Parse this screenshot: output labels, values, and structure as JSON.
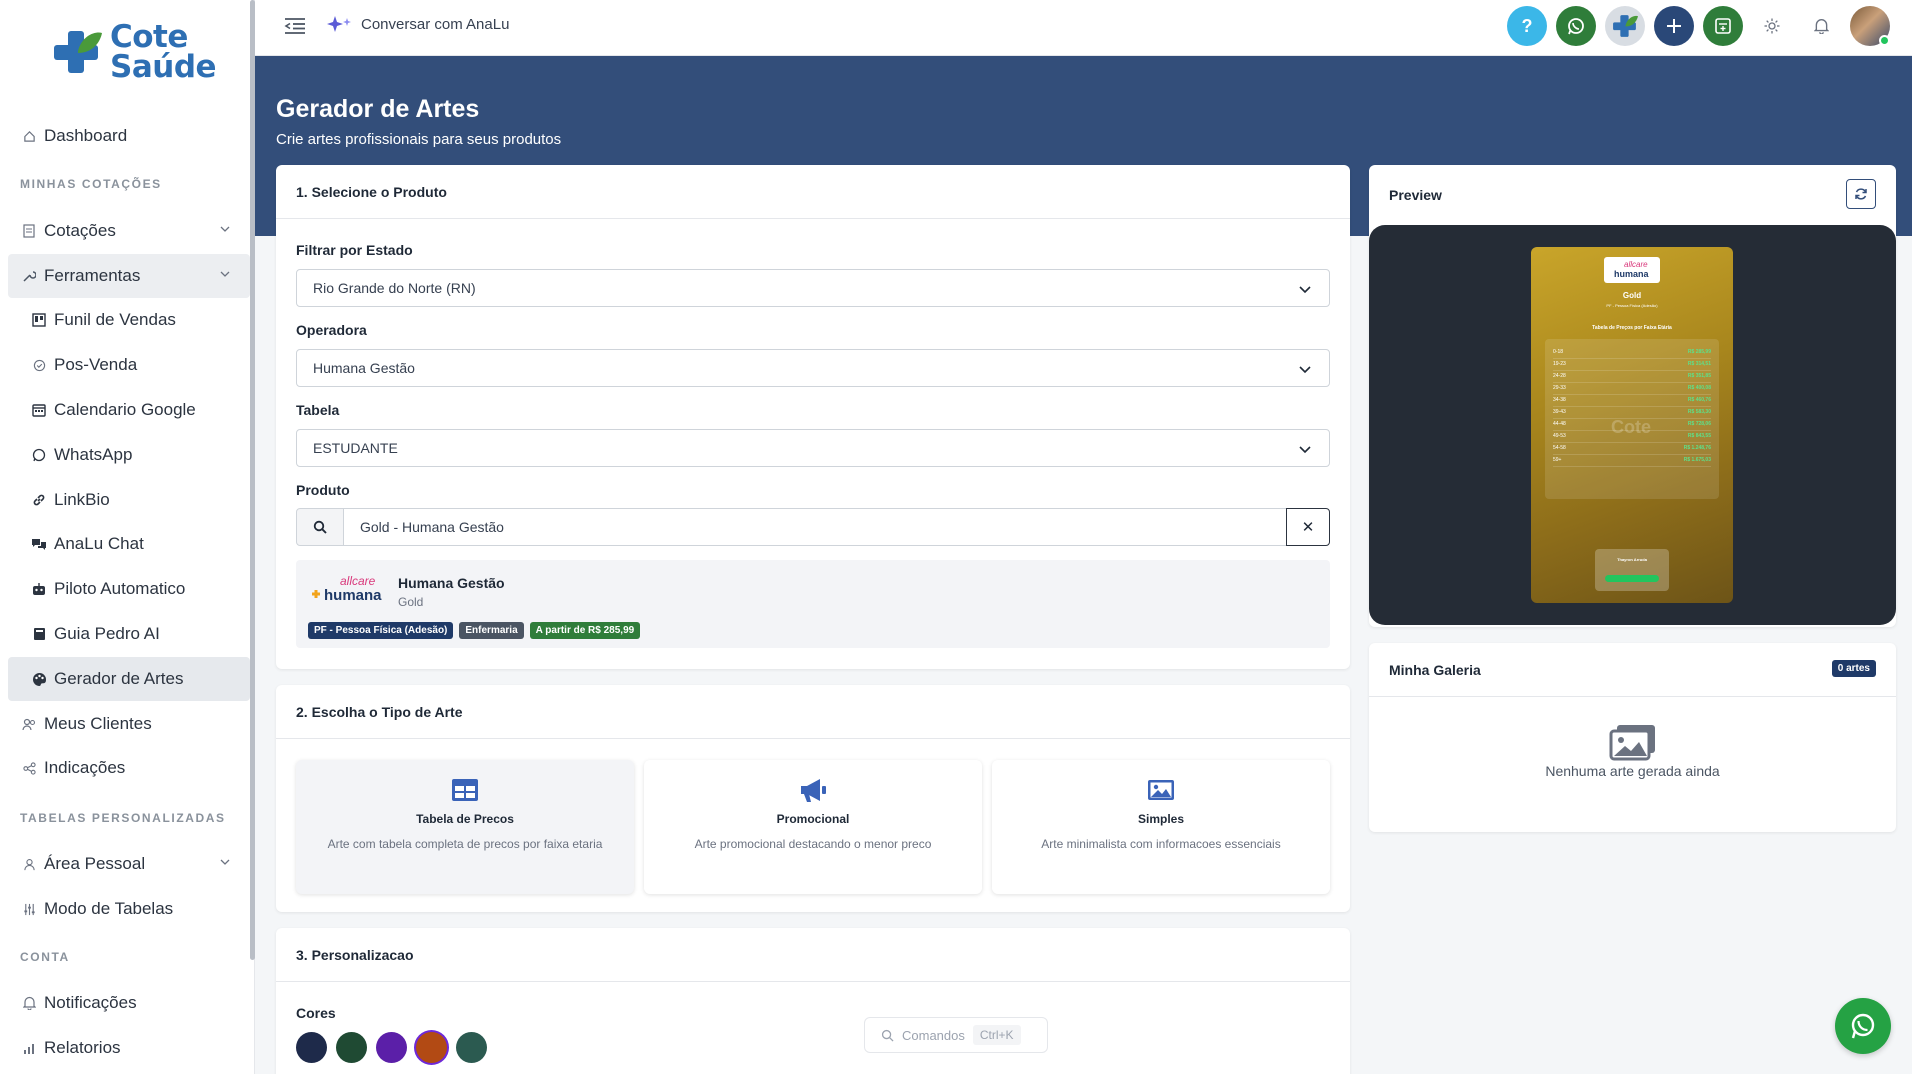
{
  "brand": {
    "line1": "Cote",
    "line2": "Saúde"
  },
  "topbar": {
    "chat_label": "Conversar com AnaLu"
  },
  "sidebar": {
    "items": [
      {
        "key": "dashboard",
        "label": "Dashboard"
      },
      {
        "key": "cotacoes",
        "label": "Cotações"
      },
      {
        "key": "ferramentas",
        "label": "Ferramentas"
      },
      {
        "key": "funil",
        "label": "Funil de Vendas"
      },
      {
        "key": "posvenda",
        "label": "Pos-Venda"
      },
      {
        "key": "calendario",
        "label": "Calendario Google"
      },
      {
        "key": "whatsapp",
        "label": "WhatsApp"
      },
      {
        "key": "linkbio",
        "label": "LinkBio"
      },
      {
        "key": "analu",
        "label": "AnaLu Chat"
      },
      {
        "key": "piloto",
        "label": "Piloto Automatico"
      },
      {
        "key": "guia",
        "label": "Guia Pedro AI"
      },
      {
        "key": "gerador",
        "label": "Gerador de Artes"
      },
      {
        "key": "clientes",
        "label": "Meus Clientes"
      },
      {
        "key": "indicacoes",
        "label": "Indicações"
      },
      {
        "key": "area",
        "label": "Área Pessoal"
      },
      {
        "key": "modo",
        "label": "Modo de Tabelas"
      },
      {
        "key": "notificacoes",
        "label": "Notificações"
      },
      {
        "key": "relatorios",
        "label": "Relatorios"
      }
    ],
    "sections": {
      "minhas": "MINHAS COTAÇÕES",
      "tabelas": "TABELAS PERSONALIZADAS",
      "conta": "CONTA"
    }
  },
  "page": {
    "title": "Gerador de Artes",
    "subtitle": "Crie artes profissionais para seus produtos"
  },
  "step1": {
    "title": "1. Selecione o Produto",
    "estado_label": "Filtrar por Estado",
    "estado_value": "Rio Grande do Norte (RN)",
    "operadora_label": "Operadora",
    "operadora_value": "Humana Gestão",
    "tabela_label": "Tabela",
    "tabela_value": "ESTUDANTE",
    "produto_label": "Produto",
    "produto_value": "Gold - Humana Gestão",
    "selected_product": {
      "logo_top": "allcare",
      "logo_main": "humana",
      "name": "Humana Gestão",
      "plan": "Gold",
      "badges": [
        {
          "text": "PF - Pessoa Física (Adesão)",
          "color": "#1f3a68"
        },
        {
          "text": "Enfermaria",
          "color": "#4b5563"
        },
        {
          "text": "A partir de R$ 285,99",
          "color": "#2f7d3a"
        }
      ]
    }
  },
  "step2": {
    "title": "2. Escolha o Tipo de Arte",
    "types": [
      {
        "title": "Tabela de Precos",
        "desc": "Arte com tabela completa de precos por faixa etaria",
        "icon": "table-icon"
      },
      {
        "title": "Promocional",
        "desc": "Arte promocional destacando o menor preco",
        "icon": "megaphone-icon"
      },
      {
        "title": "Simples",
        "desc": "Arte minimalista com informacoes essenciais",
        "icon": "image-icon"
      }
    ]
  },
  "step3": {
    "title": "3. Personalizacao",
    "colors_label": "Cores",
    "colors": [
      "#1e2a4a",
      "#1f4a33",
      "#5b1fa8",
      "#b24a14",
      "#2b5a50"
    ],
    "selected_color_index": 3
  },
  "commands": {
    "label": "Comandos",
    "shortcut": "Ctrl+K"
  },
  "preview": {
    "title": "Preview",
    "art": {
      "plan": "Gold",
      "category": "PF - Pessoa Física (Adesão)",
      "table_title": "Tabela de Preços por Faixa Etária",
      "ages": [
        "0-18",
        "19-23",
        "24-28",
        "29-33",
        "34-38",
        "39-43",
        "44-48",
        "49-53",
        "54-58",
        "59+"
      ],
      "prices": [
        "R$ 285,99",
        "R$ 314,51",
        "R$ 351,85",
        "R$ 400,08",
        "R$ 460,76",
        "R$ 583,30",
        "R$ 728,06",
        "R$ 843,55",
        "R$ 1.248,76",
        "R$ 1.675,03"
      ],
      "contact_name": "Thayron Arruda"
    }
  },
  "gallery": {
    "title": "Minha Galeria",
    "badge": "0 artes",
    "empty": "Nenhuma arte gerada ainda"
  }
}
